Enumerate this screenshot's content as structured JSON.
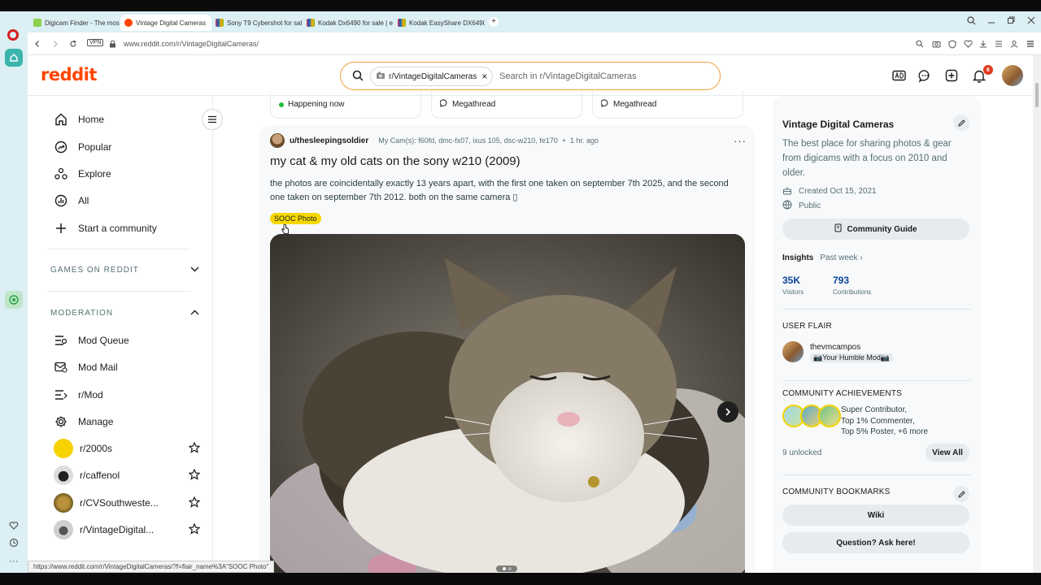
{
  "browser": {
    "tabs": [
      {
        "label": "Digicam Finder - The mos",
        "color": "#8bd14d"
      },
      {
        "label": "Vintage Digital Cameras",
        "color": "#ff4500"
      },
      {
        "label": "Sony T9 Cybershot for sal",
        "color": "#555555"
      },
      {
        "label": "Kodak Dx6490 for sale | e",
        "color": "#555555"
      },
      {
        "label": "Kodak EasyShare DX6490",
        "color": "#555555"
      }
    ],
    "new_tab": "+",
    "vpn": "VPN",
    "url": "www.reddit.com/r/VintageDigitalCameras/",
    "status_url": "https://www.reddit.com/r/VintageDigitalCameras/?f=flair_name%3A\"SOOC Photo\""
  },
  "header": {
    "logo": "reddit",
    "search_chip": "r/VintageDigitalCameras",
    "search_chip_close": "×",
    "search_placeholder": "Search in r/VintageDigitalCameras",
    "notif_count": "6"
  },
  "nav": {
    "main": [
      {
        "label": "Home",
        "icon": "home-icon"
      },
      {
        "label": "Popular",
        "icon": "popular-icon"
      },
      {
        "label": "Explore",
        "icon": "explore-icon"
      },
      {
        "label": "All",
        "icon": "all-icon"
      },
      {
        "label": "Start a community",
        "icon": "plus-icon"
      }
    ],
    "games_heading": "GAMES ON REDDIT",
    "moderation_heading": "MODERATION",
    "moderation": [
      {
        "label": "Mod Queue",
        "icon": "mod-queue-icon"
      },
      {
        "label": "Mod Mail",
        "icon": "mod-mail-icon"
      },
      {
        "label": "r/Mod",
        "icon": "r-mod-icon"
      },
      {
        "label": "Manage",
        "icon": "gear-icon"
      }
    ],
    "communities": [
      {
        "label": "r/2000s"
      },
      {
        "label": "r/caffenol"
      },
      {
        "label": "r/CVSouthweste..."
      },
      {
        "label": "r/VintageDigital..."
      }
    ]
  },
  "feed": {
    "pills": [
      "Happening now",
      "Megathread",
      "Megathread"
    ],
    "post": {
      "author": "u/thesleepingsoldier",
      "flair_text": "My Cam(s): f60fd, dmc-fx07, ixus 105, dsc-w210, fe170",
      "bullet": "•",
      "time": "1 hr. ago",
      "more": "···",
      "title": "my cat & my old cats on the sony w210 (2009)",
      "body": "the photos are coincidentally exactly 13 years apart, with the first one taken on september 7th 2025, and the second one taken on september 7th 2012. both on the same camera ▯",
      "tag": "SOOC Photo",
      "image_alt": "tabby and white cat sleeping on a floral blanket"
    }
  },
  "sidebar": {
    "title": "Vintage Digital Cameras",
    "description": "The best place for sharing photos & gear from digicams with a focus on 2010 and older.",
    "created": "Created Oct 15, 2021",
    "visibility": "Public",
    "guide_button": "Community Guide",
    "insights_label": "Insights",
    "insights_range": "Past week ›",
    "visitors_value": "35K",
    "visitors_label": "Visitors",
    "contrib_value": "793",
    "contrib_label": "Contributions",
    "user_flair_heading": "USER FLAIR",
    "flair_user": "thevmcampos",
    "flair_tag": "📷Your Humble Mod📷",
    "achievements_heading": "COMMUNITY ACHIEVEMENTS",
    "achievements": [
      "Super Contributor,",
      "Top 1% Commenter,",
      "Top 5% Poster, +6 more"
    ],
    "unlocked": "9 unlocked",
    "view_all": "View All",
    "bookmarks_heading": "COMMUNITY BOOKMARKS",
    "bookmarks": [
      "Wiki",
      "Question? Ask here!"
    ]
  },
  "colors": {
    "accent": "#ff4500",
    "flair": "#f5d800",
    "link_blue": "#0a449b"
  }
}
